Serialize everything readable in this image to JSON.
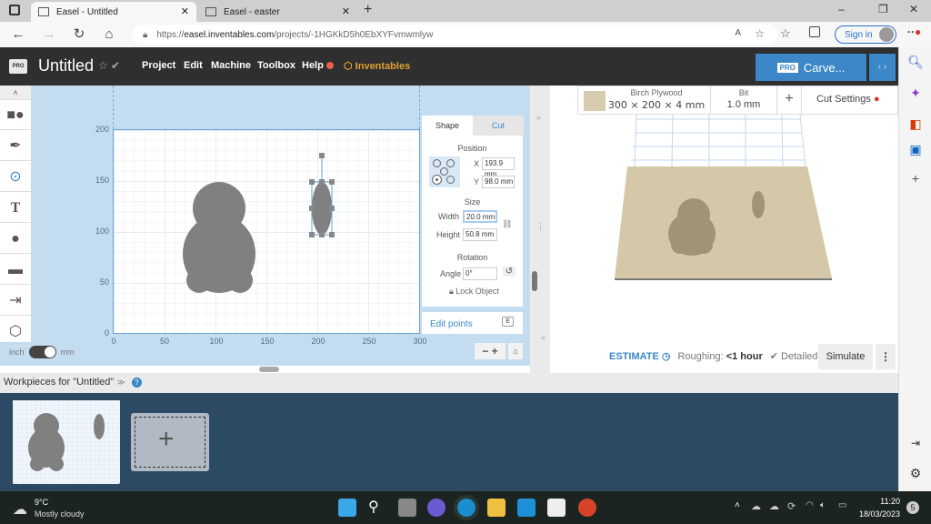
{
  "browser": {
    "tabs": [
      {
        "label": "Easel - Untitled",
        "active": true
      },
      {
        "label": "Easel - easter",
        "active": false
      }
    ],
    "new_tab": "+",
    "url_prefix": "https://",
    "url_domain": "easel.inventables.com",
    "url_path": "/projects/-1HGKkD5h0EbXYFvmwmlyw",
    "sign_in": "Sign in",
    "window_controls": [
      "–",
      "❐",
      "✕"
    ]
  },
  "app": {
    "logo": "PRO",
    "title": "Untitled",
    "menu": [
      "Project",
      "Edit",
      "Machine",
      "Toolbox",
      "Help"
    ],
    "brand": "Inventables",
    "carve_badge": "PRO",
    "carve_label": "Carve..."
  },
  "units": {
    "left": "inch",
    "right": "mm"
  },
  "canvas": {
    "y_ticks": [
      "200",
      "150",
      "100",
      "50",
      "0"
    ],
    "x_ticks": [
      "0",
      "50",
      "100",
      "150",
      "200",
      "250",
      "300"
    ]
  },
  "shape_panel": {
    "tabs": [
      "Shape",
      "Cut"
    ],
    "position_label": "Position",
    "x_label": "X",
    "x_value": "193.9 mm",
    "y_label": "Y",
    "y_value": "98.0 mm",
    "size_label": "Size",
    "width_label": "Width",
    "width_value": "20.0 mm",
    "height_label": "Height",
    "height_value": "50.8 mm",
    "rotation_label": "Rotation",
    "angle_label": "Angle",
    "angle_value": "0°",
    "lock_label": "Lock Object",
    "edit_points": "Edit points",
    "edit_key": "E"
  },
  "material": {
    "name": "Birch Plywood",
    "dims": "300 × 200 × 4 mm",
    "bit_label": "Bit",
    "bit_value": "1.0 mm",
    "cut_settings": "Cut Settings"
  },
  "estimate": {
    "label": "ESTIMATE",
    "roughing_label": "Roughing:",
    "roughing_value": "<1 hour",
    "detailed": "Detailed",
    "simulate": "Simulate"
  },
  "workpieces": {
    "title": "Workpieces for \"Untitled\""
  },
  "taskbar": {
    "temp": "9°C",
    "weather": "Mostly cloudy",
    "time": "11:20",
    "date": "18/03/2023",
    "notif_count": "5"
  }
}
